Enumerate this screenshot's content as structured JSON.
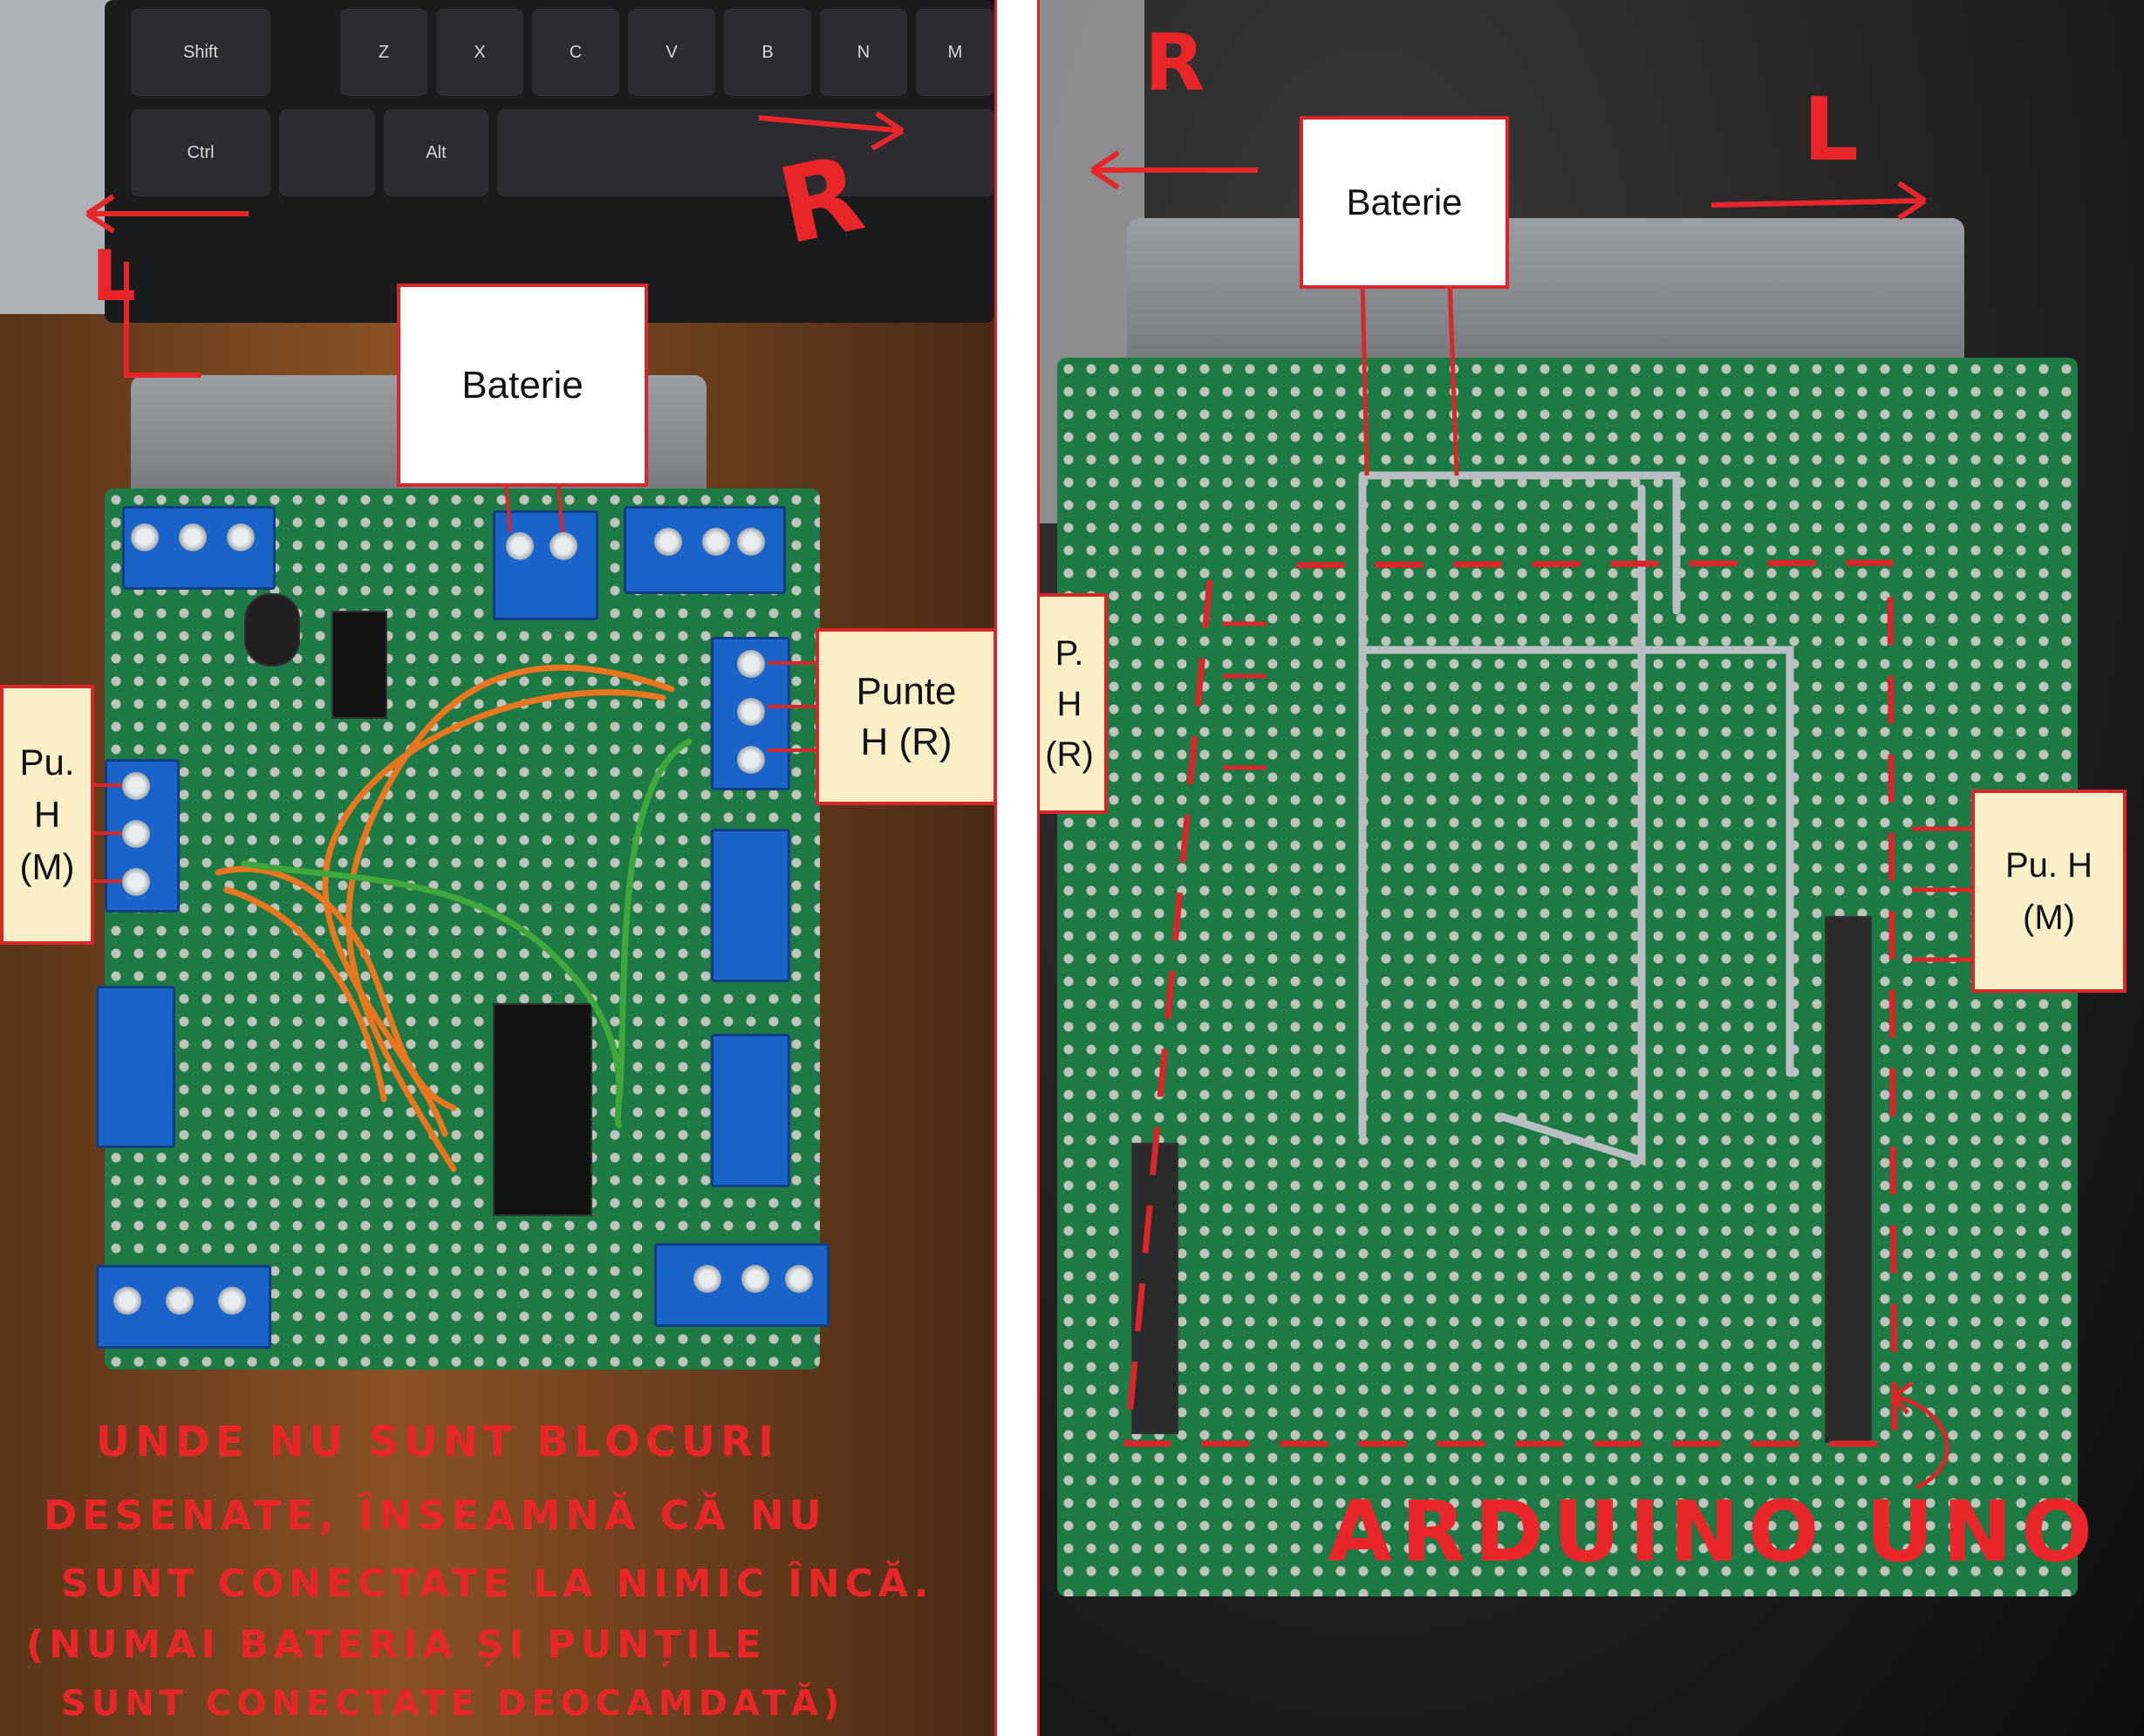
{
  "left_photo": {
    "keyboard_keys": [
      "Shift",
      "Z",
      "X",
      "C",
      "V",
      "B",
      "N",
      "M",
      "Ctrl",
      "Alt"
    ],
    "direction_left": "L",
    "direction_right": "R",
    "battery_label": "Baterie",
    "bridge_right_label": "Punte\nH (R)",
    "bridge_motor_label": "Pu.\nH\n(M)",
    "note_lines": [
      "UNDE NU SUNT BLOCURI",
      "DESENATE, ÎNSEAMNĂ CĂ NU",
      "SUNT CONECTATE LA NIMIC ÎNCĂ.",
      "(NUMAI BATERIA ȘI PUNȚILE",
      "SUNT CONECTATE DEOCAMDATĂ)"
    ]
  },
  "right_photo": {
    "direction_left": "L",
    "direction_right": "R",
    "battery_label": "Baterie",
    "bridge_right_label": "P.\nH\n(R)",
    "bridge_motor_label": "Pu. H\n(M)",
    "arduino_label": "ARDUINO UNO"
  },
  "colors": {
    "annotation_red": "#d8262a",
    "board_green": "#1e7a45",
    "terminal_blue": "#1a63c8",
    "wire_orange": "#e8761e",
    "wire_green": "#3fa83a",
    "label_cream": "#fbefc8"
  }
}
